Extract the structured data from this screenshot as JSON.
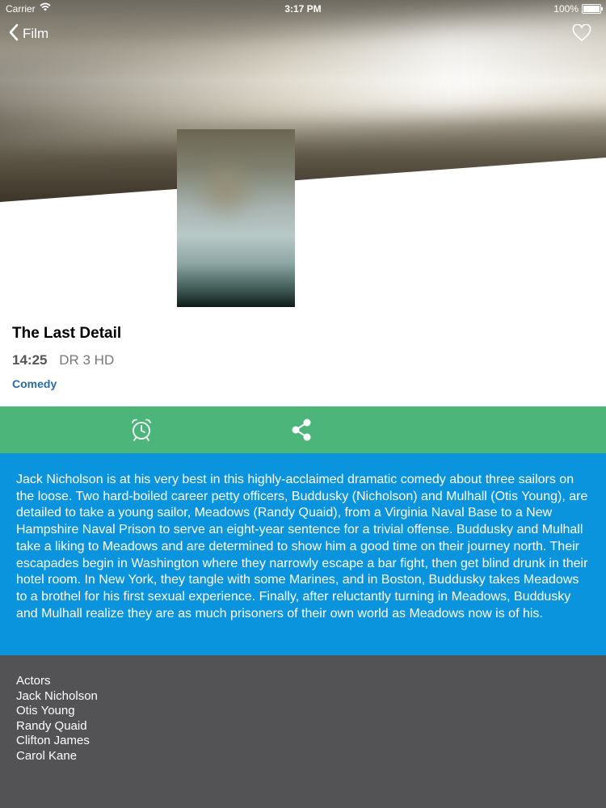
{
  "status_bar": {
    "carrier": "Carrier",
    "time": "3:17 PM",
    "battery": "100%"
  },
  "nav": {
    "back_label": "Film",
    "back_icon": "chevron-left-icon",
    "favorite_icon": "heart-outline-icon"
  },
  "program": {
    "title": "The Last Detail",
    "time": "14:25",
    "channel": "DR 3 HD",
    "genre": "Comedy"
  },
  "actions": {
    "reminder_icon": "alarm-clock-icon",
    "share_icon": "share-icon",
    "color": "#4cb67a"
  },
  "description": {
    "text": "Jack Nicholson is at his very best in this highly-acclaimed dramatic comedy about three sailors on the loose. Two hard-boiled career petty officers, Buddusky (Nicholson) and Mulhall (Otis Young), are detailed to take a young sailor, Meadows (Randy Quaid), from a Virginia Naval Base to a New Hampshire Naval Prison to serve an eight-year sentence for a trivial offense. Buddusky and Mulhall take a liking to Meadows and are determined to show him a good time on their journey north. Their escapades begin in Washington where they narrowly escape a bar fight, then get blind drunk in their hotel room. In New York, they tangle with some Marines, and in Boston, Buddusky takes Meadows to a brothel for his first sexual experience. Finally, after reluctantly turning in Meadows, Buddusky and Mulhall realize they are as much prisoners of their own world as Meadows now is of his.",
    "color": "#0a94dd"
  },
  "actors": {
    "heading": "Actors",
    "names": [
      "Jack Nicholson",
      "Otis Young",
      "Randy Quaid",
      "Clifton James",
      "Carol Kane"
    ],
    "color": "#535355"
  }
}
